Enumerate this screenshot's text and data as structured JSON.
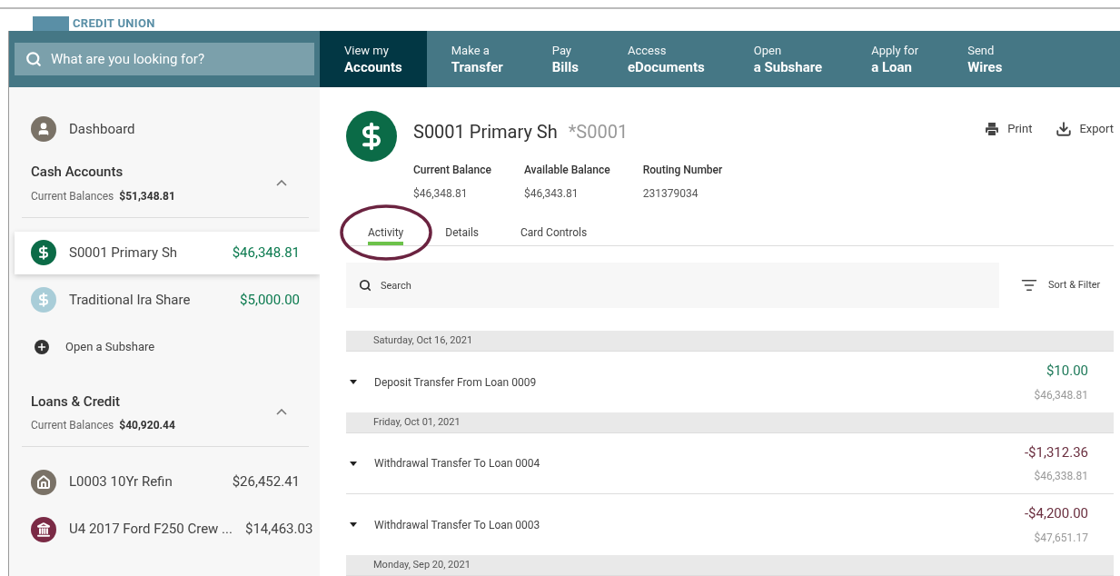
{
  "logo": {
    "text": "CREDIT UNION"
  },
  "search": {
    "placeholder": "What are you looking for?"
  },
  "nav": [
    {
      "top": "View my",
      "bottom": "Accounts",
      "selected": true
    },
    {
      "top": "Make a",
      "bottom": "Transfer",
      "selected": false
    },
    {
      "top": "Pay",
      "bottom": "Bills",
      "selected": false
    },
    {
      "top": "Access",
      "bottom": "eDocuments",
      "selected": false
    },
    {
      "top": "Open",
      "bottom": "a Subshare",
      "selected": false
    },
    {
      "top": "Apply for",
      "bottom": "a Loan",
      "selected": false
    },
    {
      "top": "Send",
      "bottom": "Wires",
      "selected": false
    }
  ],
  "sidebar": {
    "dashboard": "Dashboard",
    "groups": [
      {
        "title": "Cash Accounts",
        "balance_label": "Current Balances",
        "balance": "$51,348.81",
        "expanded": true,
        "items": [
          {
            "kind": "share",
            "name": "S0001 Primary Sh",
            "amount": "$46,348.81",
            "selected": true,
            "color": "#0b6b47"
          },
          {
            "kind": "share",
            "name": "Traditional Ira Share",
            "amount": "$5,000.00",
            "selected": false,
            "color": "#a9cdd8"
          },
          {
            "kind": "add",
            "name": "Open a Subshare"
          }
        ]
      },
      {
        "title": "Loans & Credit",
        "balance_label": "Current Balances",
        "balance": "$40,920.44",
        "expanded": true,
        "items": [
          {
            "kind": "home",
            "name": "L0003 10Yr Refin",
            "amount": "$26,452.41",
            "selected": false,
            "color": "#7a7267"
          },
          {
            "kind": "bank",
            "name": "U4 2017 Ford F250 Crew ...",
            "amount": "$14,463.03",
            "selected": false,
            "color": "#7a2a45"
          }
        ]
      }
    ]
  },
  "account": {
    "name": "S0001 Primary Sh",
    "number": "*S0001",
    "actions": [
      "Print",
      "Export"
    ],
    "stats": [
      {
        "label": "Current Balance",
        "value": "$46,348.81"
      },
      {
        "label": "Available Balance",
        "value": "$46,343.81"
      },
      {
        "label": "Routing Number",
        "value": "231379034"
      }
    ]
  },
  "tabs": [
    {
      "label": "Activity",
      "selected": true,
      "circled": true
    },
    {
      "label": "Details",
      "selected": false,
      "circled": false
    },
    {
      "label": "Card Controls",
      "selected": false,
      "circled": false
    }
  ],
  "activity_search": {
    "value": "Search"
  },
  "sort_filter": "Sort & Filter",
  "days": [
    {
      "date": "Saturday, Oct 16, 2021",
      "rows": [
        {
          "kind": "deposit",
          "description": "Deposit Transfer From Loan 0009",
          "amount": "$10.00",
          "balance": "$46,348.81"
        }
      ]
    },
    {
      "date": "Friday, Oct 01, 2021",
      "rows": [
        {
          "kind": "withdrawal",
          "description": "Withdrawal Transfer To Loan 0004",
          "amount": "-$1,312.36",
          "balance": "$46,338.81"
        },
        {
          "kind": "withdrawal",
          "description": "Withdrawal Transfer To Loan 0003",
          "amount": "-$4,200.00",
          "balance": "$47,651.17"
        }
      ]
    },
    {
      "date": "Monday, Sep 20, 2021"
    }
  ]
}
